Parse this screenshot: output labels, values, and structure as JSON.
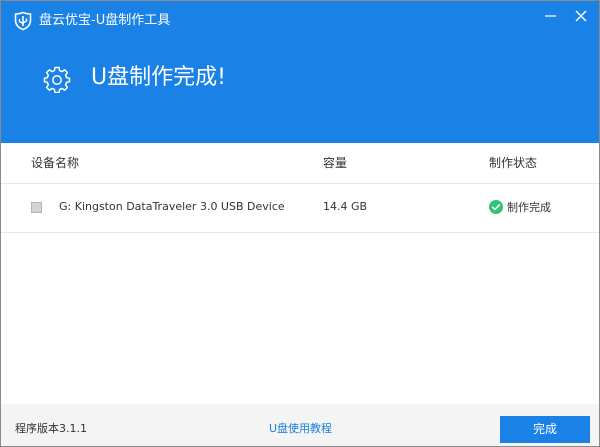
{
  "window": {
    "title": "盘云优宝-U盘制作工具",
    "hero_title": "U盘制作完成!"
  },
  "table": {
    "columns": {
      "device": "设备名称",
      "capacity": "容量",
      "status": "制作状态"
    },
    "rows": [
      {
        "device": "G: Kingston DataTraveler 3.0 USB Device",
        "capacity": "14.4 GB",
        "status": "制作完成",
        "checked": false
      }
    ]
  },
  "footer": {
    "version": "程序版本3.1.1",
    "help_link": "U盘使用教程",
    "done_button": "完成"
  },
  "colors": {
    "brand_blue": "#1a82e7",
    "success_green": "#31c27c",
    "link_blue": "#1a7fe0"
  },
  "icons": {
    "app_logo": "usb-shield-icon",
    "hero": "gear-icon",
    "status": "check-circle-icon",
    "minimize": "minimize-icon",
    "close": "close-icon"
  }
}
